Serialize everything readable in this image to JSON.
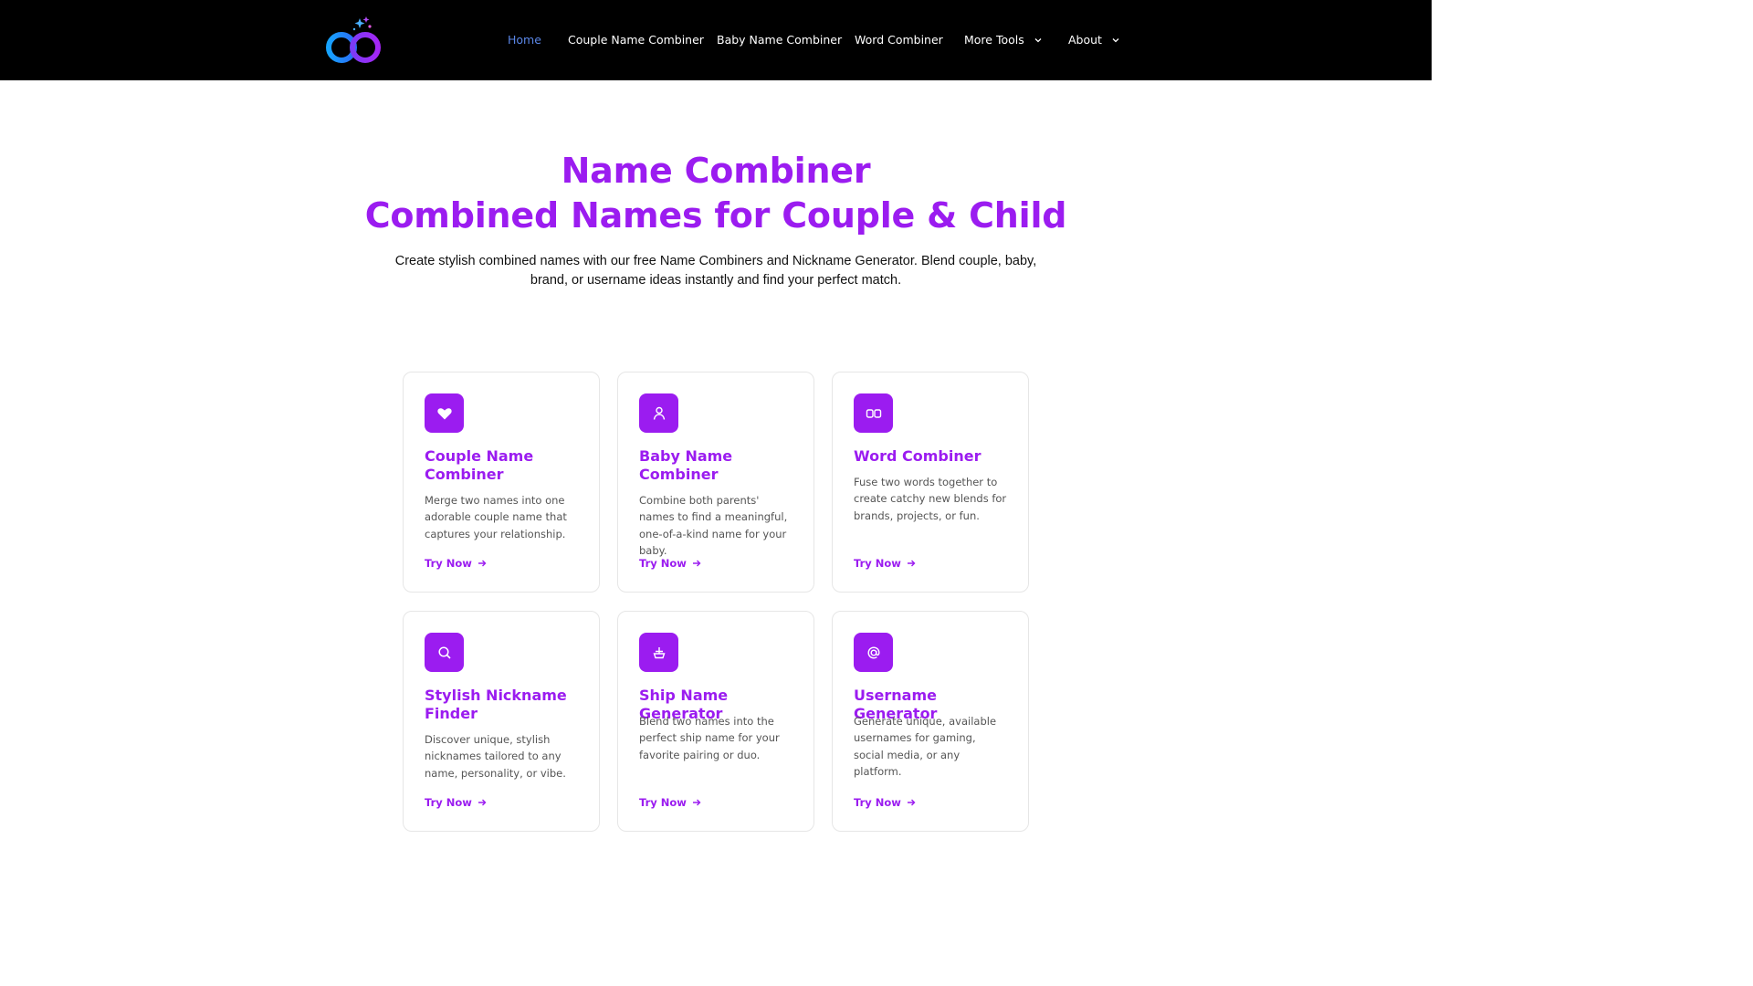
{
  "nav": {
    "items": [
      {
        "label": "Home",
        "active": true
      },
      {
        "label": "Couple Name Combiner"
      },
      {
        "label": "Baby Name Combiner"
      },
      {
        "label": "Word Combiner"
      },
      {
        "label": "More Tools",
        "dropdown": true
      },
      {
        "label": "About",
        "dropdown": true
      }
    ]
  },
  "hero": {
    "title_line1": "Name Combiner",
    "title_line2": "Combined Names for Couple & Child",
    "description": "Create stylish combined names with our free Name Combiners and Nickname Generator. Blend couple, baby, brand, or username ideas instantly and find your perfect match."
  },
  "cards": [
    {
      "icon": "heart-icon",
      "title": "Couple Name Combiner",
      "text": "Merge two names into one adorable couple name that captures your relationship.",
      "link": "Try Now"
    },
    {
      "icon": "person-icon",
      "title": "Baby Name Combiner",
      "text": "Combine both parents' names to find a meaningful, one-of-a-kind name for your baby.",
      "link": "Try Now"
    },
    {
      "icon": "link-icon",
      "title": "Word Combiner",
      "text": "Fuse two words together to create catchy new blends for brands, projects, or fun.",
      "link": "Try Now"
    },
    {
      "icon": "search-icon",
      "title": "Stylish Nickname Finder",
      "text": "Discover unique, stylish nicknames tailored to any name, personality, or vibe.",
      "link": "Try Now"
    },
    {
      "icon": "ship-icon",
      "title": "Ship Name Generator",
      "text": "Blend two names into the perfect ship name for your favorite pairing or duo.",
      "link": "Try Now"
    },
    {
      "icon": "at-icon",
      "title": "Username Generator",
      "text": "Generate unique, available usernames for gaming, social media, or any platform.",
      "link": "Try Now"
    }
  ],
  "colors": {
    "accent": "#9b1cf0",
    "nav_active": "#5a86e6",
    "header_bg": "#000000"
  }
}
